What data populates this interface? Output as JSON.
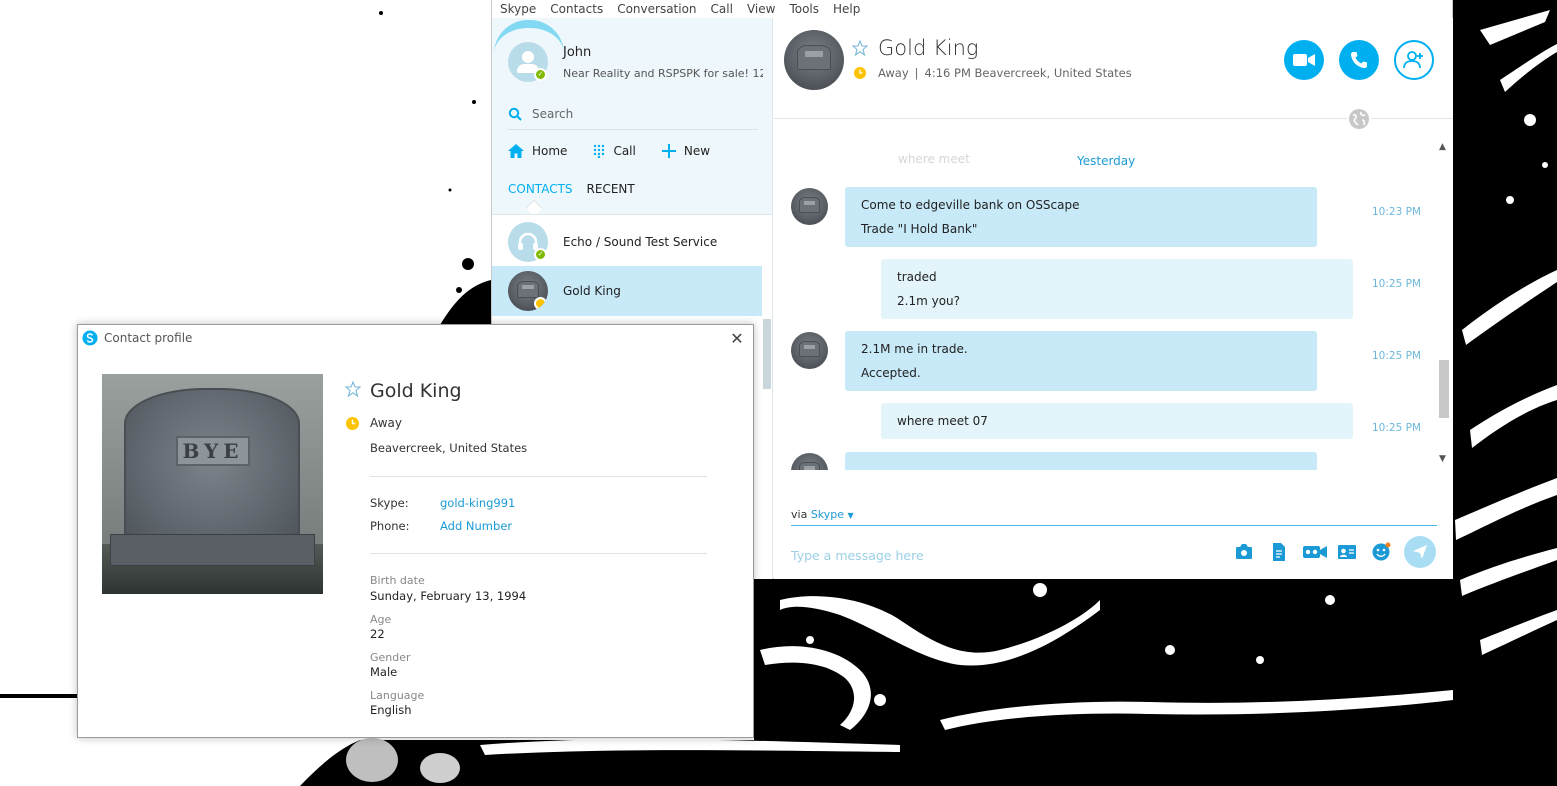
{
  "menu": [
    "Skype",
    "Contacts",
    "Conversation",
    "Call",
    "View",
    "Tools",
    "Help"
  ],
  "me": {
    "name": "John",
    "mood": "Near Reality and RSPSPK for sale! 12..."
  },
  "search": {
    "placeholder": "Search"
  },
  "nav": {
    "home": "Home",
    "call": "Call",
    "new": "New"
  },
  "list_tabs": {
    "contacts": "CONTACTS",
    "recent": "RECENT"
  },
  "contacts": [
    {
      "name": "Echo / Sound Test Service",
      "status": "online"
    },
    {
      "name": "Gold King",
      "status": "away"
    }
  ],
  "chat": {
    "name": "Gold King",
    "status": "Away",
    "separator": "|",
    "local_time": "4:16 PM Beavercreek, United States",
    "day_label": "Yesterday",
    "ghost_text": "where meet",
    "messages": [
      {
        "direction": "in",
        "lines": [
          "Come to edgeville bank on OSScape",
          "Trade \"I Hold Bank\""
        ],
        "time": "10:23 PM"
      },
      {
        "direction": "out",
        "lines": [
          "traded",
          "2.1m you?"
        ],
        "time": "10:25 PM"
      },
      {
        "direction": "in",
        "lines": [
          "2.1M me in trade.",
          "Accepted."
        ],
        "time": "10:25 PM"
      },
      {
        "direction": "out",
        "lines": [
          "where meet 07"
        ],
        "time": "10:25 PM"
      }
    ],
    "via_prefix": "via",
    "via_service": "Skype",
    "input_placeholder": "Type a message here"
  },
  "profile": {
    "window_title": "Contact profile",
    "photo_text": "BYE",
    "name": "Gold King",
    "status": "Away",
    "location": "Beavercreek, United States",
    "skype_label": "Skype:",
    "skype_value": "gold-king991",
    "phone_label": "Phone:",
    "phone_value": "Add Number",
    "birth_label": "Birth date",
    "birth_value": "Sunday, February 13, 1994",
    "age_label": "Age",
    "age_value": "22",
    "gender_label": "Gender",
    "gender_value": "Male",
    "language_label": "Language",
    "language_value": "English"
  },
  "colors": {
    "accent": "#00aff0",
    "away": "#fdc300",
    "online": "#7fba00",
    "bubble_in": "#c7e9f8",
    "bubble_out": "#e3f4fb"
  }
}
